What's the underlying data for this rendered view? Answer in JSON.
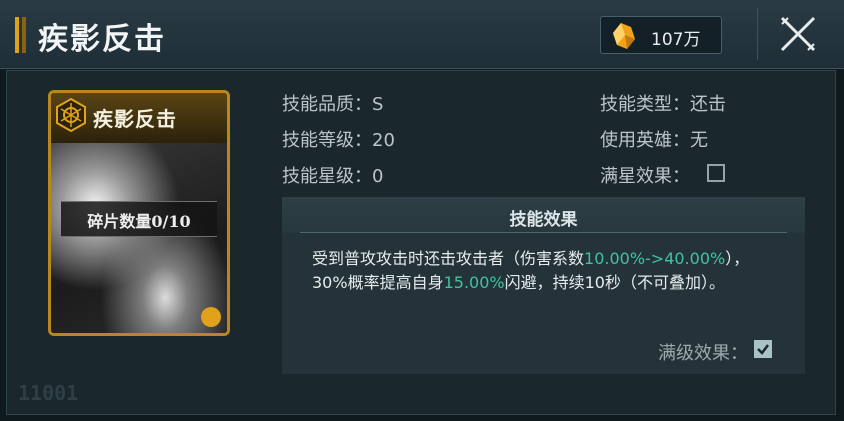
{
  "header": {
    "title": "疾影反击",
    "currency_icon": "crystal-icon",
    "currency_value": "107万",
    "close_icon": "close-icon"
  },
  "card": {
    "name": "疾影反击",
    "fragments": "碎片数量0/10",
    "emblem_icon": "hexagon-emblem-icon",
    "class_icon": "fist-icon"
  },
  "stats_left": [
    {
      "label": "技能品质：",
      "value": "S"
    },
    {
      "label": "技能等级：",
      "value": "20"
    },
    {
      "label": "技能星级：",
      "value": "0"
    }
  ],
  "stats_right": [
    {
      "label": "技能类型：",
      "value": "还击"
    },
    {
      "label": "使用英雄：",
      "value": "无"
    },
    {
      "label": "满星效果：",
      "checked": false
    }
  ],
  "effect": {
    "title": "技能效果",
    "text_1": "受到普攻攻击时还击攻击者（伤害系数",
    "hl_1": "10.00%->40.00%",
    "text_2": "），30%概率提高自身",
    "hl_2": "15.00%",
    "text_3": "闪避，持续10秒（不可叠加）。",
    "full_level_label": "满级效果：",
    "full_level_checked": true
  },
  "watermark": "11001",
  "colors": {
    "accent_gold": "#e0a21a",
    "highlight_green": "#3fc3a1"
  }
}
